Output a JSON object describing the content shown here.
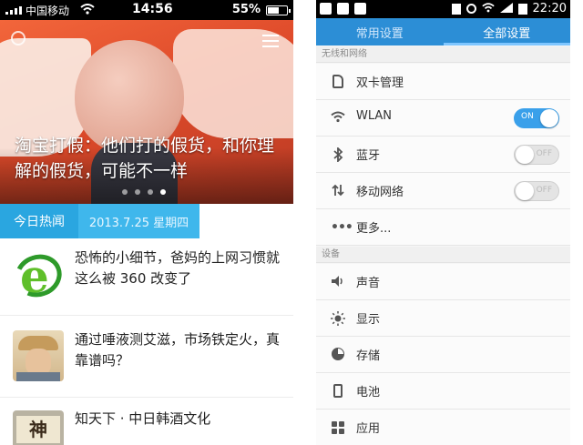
{
  "left_phone": {
    "status": {
      "carrier": "中国移动",
      "time": "14:56",
      "battery": "55%"
    },
    "hero": {
      "title": "淘宝打假：他们打的假货，和你理解的假货，可能不一样",
      "active_dot": 4
    },
    "today": {
      "tag": "今日热闻",
      "date": "2013.7.25 星期四"
    },
    "news": [
      {
        "title": "恐怖的小细节，爸妈的上网习惯就这么被 360 改变了"
      },
      {
        "title": "通过唾液测艾滋，市场铁定火，真靠谱吗？"
      },
      {
        "title": "知天下 · 中日韩酒文化",
        "thumb_text": "神"
      }
    ]
  },
  "right_phone": {
    "status": {
      "time": "22:20"
    },
    "tabs": [
      {
        "label": "常用设置"
      },
      {
        "label": "全部设置"
      }
    ],
    "sections": [
      {
        "label": "无线和网络"
      },
      {
        "label": "设备"
      }
    ],
    "rows": [
      {
        "label": "双卡管理",
        "icon": "sim-card-icon"
      },
      {
        "label": "WLAN",
        "icon": "wifi-icon",
        "toggle_text": "ON"
      },
      {
        "label": "蓝牙",
        "icon": "bluetooth-icon",
        "toggle_text": "OFF"
      },
      {
        "label": "移动网络",
        "icon": "mobile-data-icon",
        "toggle_text": "OFF"
      },
      {
        "label": "更多...",
        "icon": "more-icon"
      },
      {
        "label": "声音",
        "icon": "speaker-icon"
      },
      {
        "label": "显示",
        "icon": "brightness-icon"
      },
      {
        "label": "存储",
        "icon": "storage-icon"
      },
      {
        "label": "电池",
        "icon": "battery-icon"
      },
      {
        "label": "应用",
        "icon": "apps-icon"
      }
    ]
  }
}
